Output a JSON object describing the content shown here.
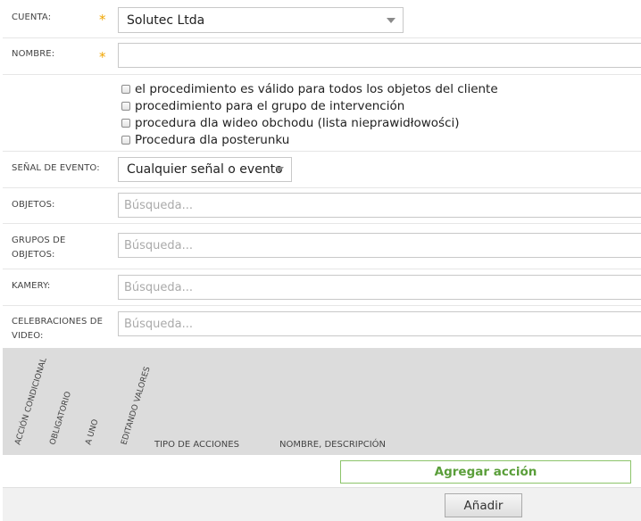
{
  "form": {
    "cuenta": {
      "label": "Cuenta:",
      "value": "Solutec Ltda"
    },
    "nombre": {
      "label": "Nombre:",
      "value": ""
    },
    "checkboxes": [
      "el procedimiento es válido para todos los objetos del cliente",
      "procedimiento para el grupo de intervención",
      "procedura dla wideo obchodu (lista nieprawidłowości)",
      "Procedura dla posterunku"
    ],
    "senal": {
      "label": "Señal de evento:",
      "value": "Cualquier señal o evento"
    },
    "objetos": {
      "label": "Objetos:",
      "placeholder": "Búsqueda..."
    },
    "grupos": {
      "label_line1": "Grupos de",
      "label_line2": "objetos:",
      "placeholder": "Búsqueda..."
    },
    "kamery": {
      "label": "Kamery:",
      "placeholder": "Búsqueda..."
    },
    "celebraciones": {
      "label_line1": "Celebraciones de",
      "label_line2": "video:",
      "placeholder": "Búsqueda..."
    }
  },
  "table": {
    "rotated_headers": [
      "Acción condicional",
      "Obligatorio",
      "A uno",
      "Editando valores"
    ],
    "headers": [
      "Tipo de acciones",
      "Nombre, descripción"
    ]
  },
  "actions": {
    "add_action": "Agregar acción",
    "add": "Añadir"
  },
  "colors": {
    "accent_green": "#5a9e3a",
    "required_star": "#f0a500",
    "table_header_bg": "#dcdcdc"
  },
  "icons": {
    "required": "asterisk",
    "dropdown": "chevron-down-icon"
  }
}
